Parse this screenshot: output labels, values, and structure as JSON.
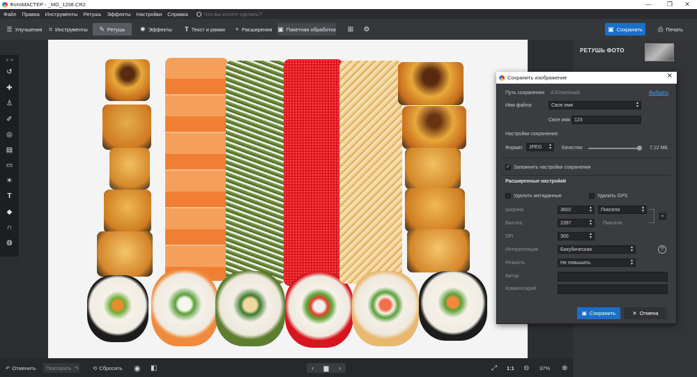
{
  "window": {
    "title": "ФотоМАСТЕР - _MG_1208.CR2",
    "minimize": "—",
    "maximize": "❐",
    "close": "✕"
  },
  "menu": {
    "items": [
      "Файл",
      "Правка",
      "Инструменты",
      "Ретушь",
      "Эффекты",
      "Настройки",
      "Справка"
    ],
    "search_placeholder": "Что вы хотите сделать?"
  },
  "toolbar": {
    "tabs": [
      {
        "label": "Улучшения",
        "icon": "sliders-icon"
      },
      {
        "label": "Инструменты",
        "icon": "crop-icon"
      },
      {
        "label": "Ретушь",
        "icon": "brush-icon"
      },
      {
        "label": "Эффекты",
        "icon": "sparkle-icon"
      },
      {
        "label": "Текст и рамки",
        "icon": "text-icon"
      },
      {
        "label": "Расширения",
        "icon": "plus-icon"
      }
    ],
    "active_tab": "Ретушь",
    "batch_label": "Пакетная обработка",
    "save_label": "Сохранить",
    "print_label": "Печать"
  },
  "right_panel": {
    "title": "РЕТУШЬ ФОТО"
  },
  "bottom_bar": {
    "undo_label": "Отменить",
    "redo_label": "Повторить",
    "reset_label": "Сбросить",
    "fit_label": "1:1",
    "zoom_value": "37%"
  },
  "dialog": {
    "title": "Сохранить изображение",
    "save_path_label": "Путь сохранения:",
    "save_path_value": "d:/Downloads",
    "browse_label": "Выбрать",
    "file_name_label": "Имя файла:",
    "file_name_value": "Свое имя",
    "custom_name_label": "Свое имя",
    "custom_name_value": "123",
    "save_settings_label": "Настройки сохранения:",
    "format_label": "Формат",
    "format_value": "JPEG",
    "quality_label": "Качество",
    "quality_fraction": 1.0,
    "file_size": "7,12 МБ",
    "remember_label": "Запомнить настройки сохранения",
    "remember_checked": true,
    "advanced_label": "Расширенные настройки",
    "remove_metadata_label": "Удалить метаданные",
    "remove_gps_label": "Удалить GPS",
    "width_label": "Ширина",
    "width_value": "3602",
    "height_label": "Высота",
    "height_value": "2397",
    "units_value": "Пиксели",
    "units_label": "Пиксели",
    "dpi_label": "DPI",
    "dpi_value": "300",
    "interp_label": "Интерполяция",
    "interp_value": "Бикубическая",
    "sharp_label": "Резкость",
    "sharp_value": "Не повышать",
    "author_label": "Автор",
    "comment_label": "Комментарий",
    "save_button": "Сохранить",
    "cancel_button": "Отмена"
  },
  "colors": {
    "accent_blue": "#1a6fc9",
    "salmon": "#f28a3c",
    "tobiko_red": "#e01b2b",
    "dill_green": "#6f8f3b",
    "baked_gold": "#e9a93a",
    "nori": "#1c1c1c"
  }
}
